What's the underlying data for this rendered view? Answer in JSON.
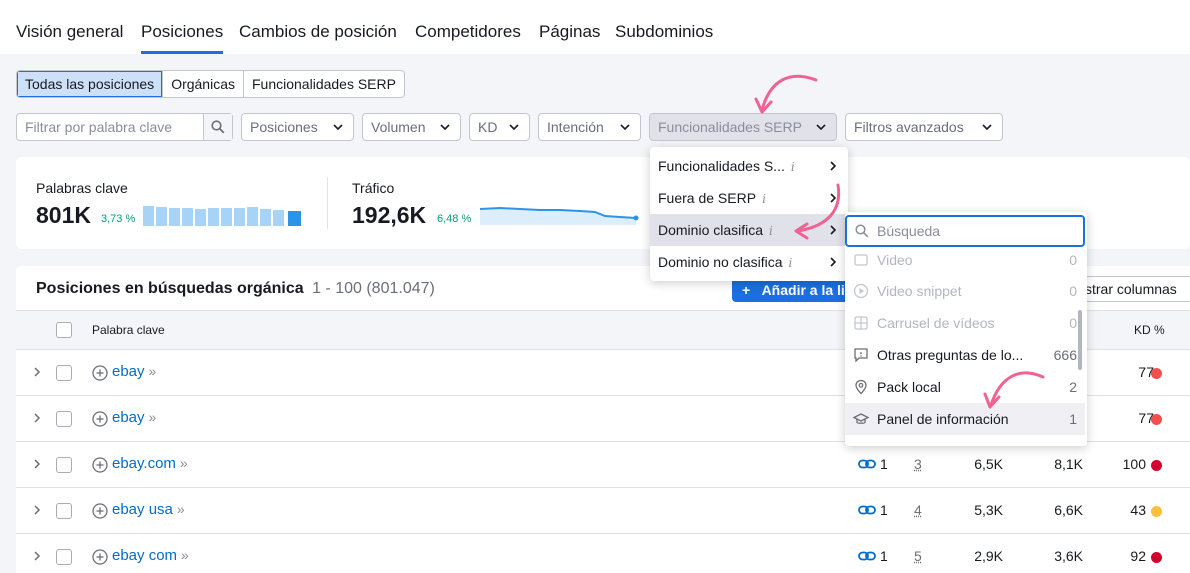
{
  "nav": {
    "tabs": [
      "Visión general",
      "Posiciones",
      "Cambios de posición",
      "Competidores",
      "Páginas",
      "Subdominios"
    ],
    "active_tab": "Posiciones"
  },
  "segments": {
    "items": [
      "Todas las posiciones",
      "Orgánicas",
      "Funcionalidades SERP"
    ],
    "active": "Todas las posiciones"
  },
  "filters": {
    "search_placeholder": "Filtrar por palabra clave",
    "dropdowns": [
      "Posiciones",
      "Volumen",
      "KD",
      "Intención",
      "Funcionalidades SERP",
      "Filtros avanzados"
    ]
  },
  "summary": {
    "keywords": {
      "label": "Palabras clave",
      "value": "801K",
      "delta": "3,73 %"
    },
    "traffic": {
      "label": "Tráfico",
      "value": "192,6K",
      "delta": "6,48 %"
    }
  },
  "table": {
    "title": "Posiciones en búsquedas orgánica",
    "range": "1 - 100 (801.047)",
    "add_button": "Añadir a la li",
    "columns_button": "strar columnas",
    "headers": {
      "keyword": "Palabra clave",
      "kd": "KD %"
    },
    "rows": [
      {
        "keyword": "ebay",
        "links": "",
        "position": "",
        "volume": "",
        "cpc": "",
        "kd": "77",
        "kd_color": "#f34f4f"
      },
      {
        "keyword": "ebay",
        "links": "",
        "position": "",
        "volume": "",
        "cpc": "",
        "kd": "77",
        "kd_color": "#f34f4f"
      },
      {
        "keyword": "ebay.com",
        "links": "1",
        "position": "3",
        "volume": "6,5K",
        "cpc": "8,1K",
        "kd": "100",
        "kd_color": "#d1002f"
      },
      {
        "keyword": "ebay usa",
        "links": "1",
        "position": "4",
        "volume": "5,3K",
        "cpc": "6,6K",
        "kd": "43",
        "kd_color": "#fbbf3b"
      },
      {
        "keyword": "ebay com",
        "links": "1",
        "position": "5",
        "volume": "2,9K",
        "cpc": "3,6K",
        "kd": "92",
        "kd_color": "#d1002f"
      }
    ]
  },
  "menu": {
    "items": [
      "Funcionalidades S...",
      "Fuera de SERP",
      "Dominio clasifica",
      "Dominio no clasifica"
    ],
    "active": "Dominio clasifica",
    "info_glyph": "i"
  },
  "submenu": {
    "search_placeholder": "Búsqueda",
    "items": [
      {
        "label": "Video",
        "count": "0",
        "disabled": true,
        "icon": "video-icon"
      },
      {
        "label": "Video snippet",
        "count": "0",
        "disabled": true,
        "icon": "play-icon"
      },
      {
        "label": "Carrusel de vídeos",
        "count": "0",
        "disabled": true,
        "icon": "video-carousel-icon"
      },
      {
        "label": "Otras preguntas de lo...",
        "count": "666",
        "disabled": false,
        "icon": "question-bubble-icon"
      },
      {
        "label": "Pack local",
        "count": "2",
        "disabled": false,
        "icon": "map-pin-icon"
      },
      {
        "label": "Panel de información",
        "count": "1",
        "disabled": false,
        "icon": "graduation-cap-icon"
      }
    ]
  },
  "colors": {
    "accent": "#1b6fde",
    "positive": "#009f81",
    "link": "#006dca",
    "annotation": "#f06292"
  }
}
